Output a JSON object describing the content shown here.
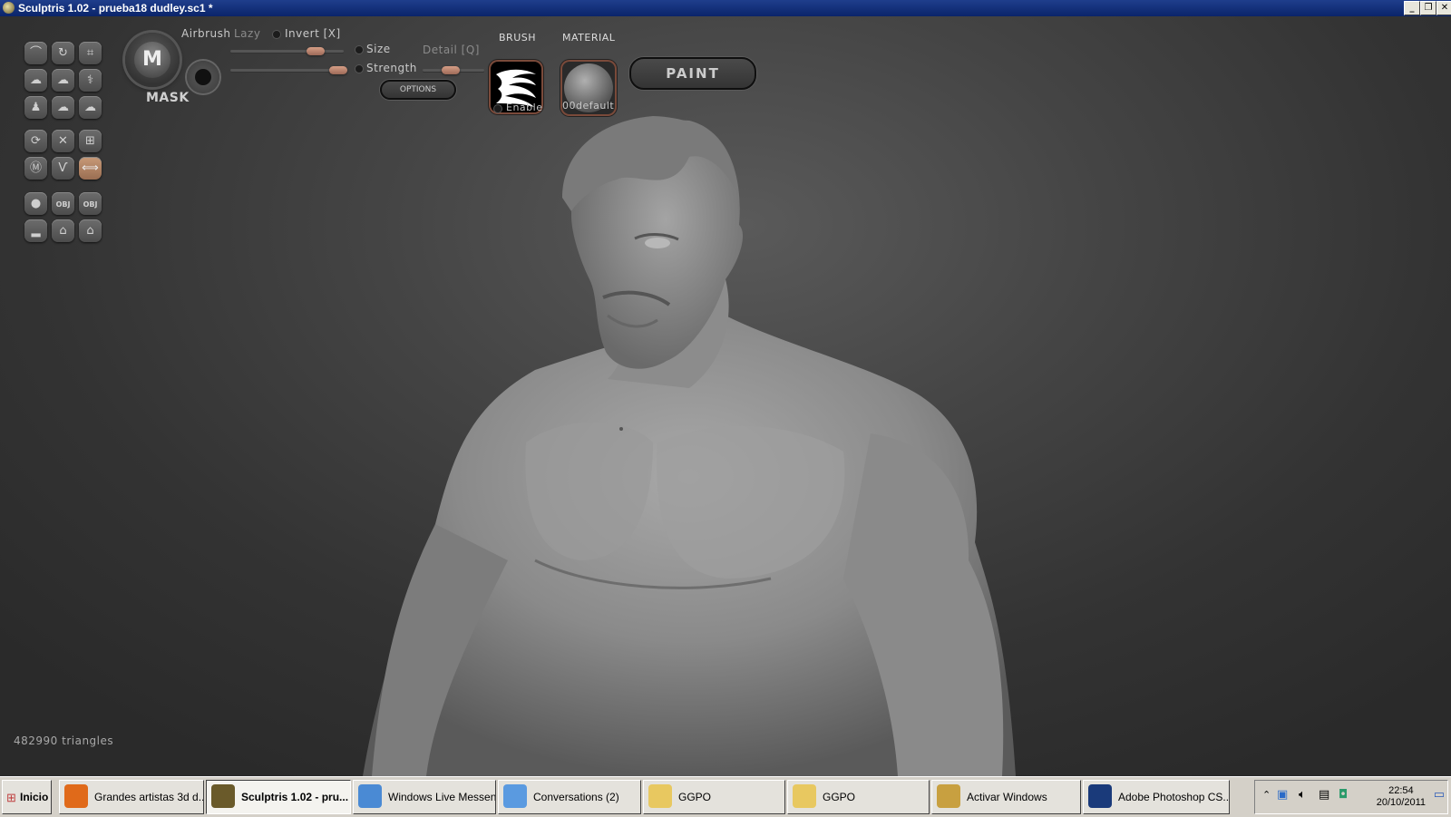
{
  "window": {
    "title": "Sculptris 1.02 - prueba18 dudley.sc1 *"
  },
  "toolbar": {
    "mask_label": "MASK",
    "mask_glyph": "M",
    "airbrush_label": "Airbrush",
    "lazy_label": "Lazy",
    "invert_label": "Invert [X]",
    "size_label": "Size",
    "strength_label": "Strength",
    "detail_label": "Detail [Q]",
    "options_label": "OPTIONS",
    "brush_label": "BRUSH",
    "enable_label": "Enable",
    "material_label": "MATERIAL",
    "material_name": "00default",
    "paint_label": "PAINT",
    "size_level": 0.75,
    "strength_level": 0.95,
    "detail_level": 0.45
  },
  "tools": [
    {
      "icon": "draw-icon",
      "glyph": "⌒"
    },
    {
      "icon": "rotate-icon",
      "glyph": "↻"
    },
    {
      "icon": "crop-icon",
      "glyph": "⌗"
    },
    {
      "icon": "inflate-icon",
      "glyph": "☁"
    },
    {
      "icon": "flatten-icon",
      "glyph": "☁"
    },
    {
      "icon": "pinch-icon",
      "glyph": "⚕"
    },
    {
      "icon": "grab-icon",
      "glyph": "♟"
    },
    {
      "icon": "crease-icon",
      "glyph": "☁"
    },
    {
      "icon": "smooth-icon",
      "glyph": "☁"
    },
    {
      "icon": "reduce-icon",
      "glyph": "⟳"
    },
    {
      "icon": "symmetry-icon",
      "glyph": "✕"
    },
    {
      "icon": "grid-icon",
      "glyph": "⊞"
    },
    {
      "icon": "mask-tool-icon",
      "glyph": "Ⓜ"
    },
    {
      "icon": "wave-icon",
      "glyph": "Ѵ"
    },
    {
      "icon": "mirror-icon",
      "glyph": "⟺"
    },
    {
      "icon": "sphere-icon",
      "glyph": "●"
    },
    {
      "icon": "import-obj-icon",
      "glyph": "OBJ"
    },
    {
      "icon": "export-obj-icon",
      "glyph": "OBJ"
    },
    {
      "icon": "plane-icon",
      "glyph": "▂"
    },
    {
      "icon": "open-icon",
      "glyph": "⌂"
    },
    {
      "icon": "save-icon",
      "glyph": "⌂"
    }
  ],
  "status": {
    "triangles": "482990 triangles"
  },
  "taskbar": {
    "start_label": "Inicio",
    "buttons": [
      {
        "label": "Grandes artistas 3d d...",
        "icon": "firefox-icon",
        "color": "#e06a1a"
      },
      {
        "label": "Sculptris 1.02 - pru...",
        "icon": "sculptris-icon",
        "color": "#6a5a2a"
      },
      {
        "label": "Windows Live Messen...",
        "icon": "messenger-icon",
        "color": "#4a8ad4"
      },
      {
        "label": "Conversations (2)",
        "icon": "conversations-icon",
        "color": "#5a9ae0"
      },
      {
        "label": "GGPO",
        "icon": "folder-icon",
        "color": "#e8c860"
      },
      {
        "label": "GGPO",
        "icon": "folder-icon",
        "color": "#e8c860"
      },
      {
        "label": "Activar Windows",
        "icon": "keys-icon",
        "color": "#c8a040"
      },
      {
        "label": "Adobe Photoshop CS...",
        "icon": "photoshop-icon",
        "color": "#1a3a7a"
      }
    ],
    "clock_time": "22:54",
    "clock_date": "20/10/2011"
  }
}
